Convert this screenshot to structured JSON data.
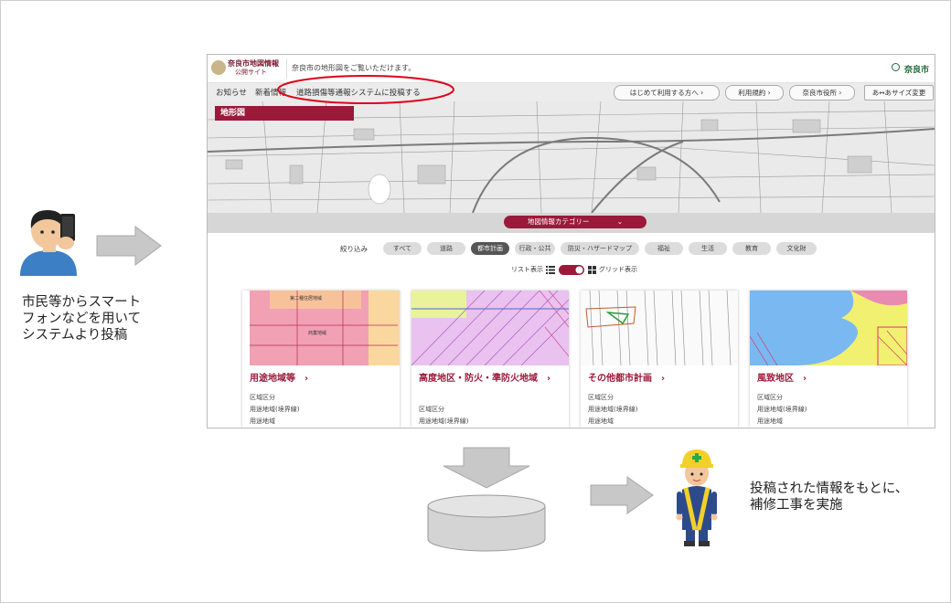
{
  "caption_left": [
    "市民等からスマート",
    "フォンなどを用いて",
    "システムより投稿"
  ],
  "caption_right": [
    "投稿された情報をもとに、",
    "補修工事を実施"
  ],
  "site": {
    "logo_line1": "奈良市地図情報",
    "logo_line2": "公開サイト",
    "tagline": "奈良市の地形図をご覧いただけます。",
    "city_logo": "奈良市"
  },
  "nav": {
    "items": [
      "お知らせ",
      "新着情報",
      "道路損傷等通報システムに投稿する"
    ],
    "pills": [
      "はじめて利用する方へ ›",
      "利用規約 ›",
      "奈良市役所 ›",
      "あ↔あサイズ変更"
    ]
  },
  "map_label": "地形図",
  "category_button": "地図情報カテゴリー",
  "filter": {
    "label": "絞り込み",
    "chips": [
      "すべて",
      "道路",
      "都市計画",
      "行政・公共",
      "防災・ハザードマップ",
      "福祉",
      "生活",
      "教育",
      "文化財"
    ],
    "active": "都市計画"
  },
  "view_toggle": {
    "list": "リスト表示",
    "grid": "グリッド表示"
  },
  "map_thumb_labels": [
    "第二種住居地域",
    "商業地域"
  ],
  "cards": [
    {
      "title": "用途地域等　›",
      "lines": [
        "区域区分",
        "用途地域(境界線)",
        "用途地域"
      ]
    },
    {
      "title": "高度地区・防火・準防火地域　›",
      "lines": [
        "区域区分",
        "用途地域(境界線)"
      ]
    },
    {
      "title": "その他都市計画　›",
      "lines": [
        "区域区分",
        "用途地域(境界線)",
        "用途地域"
      ]
    },
    {
      "title": "風致地区　›",
      "lines": [
        "区域区分",
        "用途地域(境界線)",
        "用途地域"
      ]
    }
  ],
  "colors": {
    "brand": "#9b1a3a",
    "highlight_ellipse": "#e0001b",
    "arrow": "#c8c8c8"
  }
}
